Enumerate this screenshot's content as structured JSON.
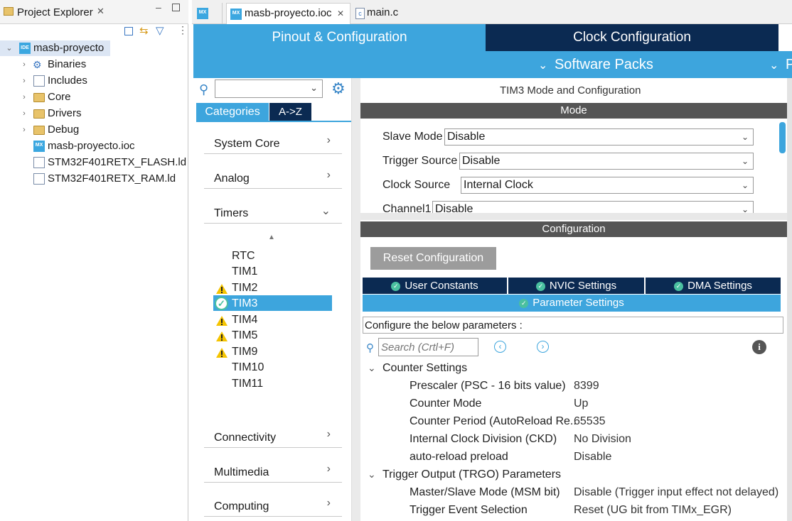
{
  "explorer": {
    "title": "Project Explorer",
    "tree": [
      {
        "label": "masb-proyecto",
        "icon": "ide-project-icon"
      },
      {
        "label": "Binaries",
        "icon": "binaries-icon"
      },
      {
        "label": "Includes",
        "icon": "includes-icon"
      },
      {
        "label": "Core",
        "icon": "folder-icon"
      },
      {
        "label": "Drivers",
        "icon": "folder-icon"
      },
      {
        "label": "Debug",
        "icon": "folder-icon"
      },
      {
        "label": "masb-proyecto.ioc",
        "icon": "mx-file-icon"
      },
      {
        "label": "STM32F401RETX_FLASH.ld",
        "icon": "ld-file-icon"
      },
      {
        "label": "STM32F401RETX_RAM.ld",
        "icon": "ld-file-icon"
      }
    ]
  },
  "editor_tabs": [
    {
      "label": "",
      "icon": "mx-icon"
    },
    {
      "label": "masb-proyecto.ioc",
      "icon": "mx-icon"
    },
    {
      "label": "main.c",
      "icon": "c-file-icon"
    }
  ],
  "top_tabs": {
    "pinout": "Pinout & Configuration",
    "clock": "Clock Configuration",
    "software_packs": "Software Packs",
    "partial_edge": "P"
  },
  "categories": {
    "toggle_categories": "Categories",
    "toggle_az": "A->Z",
    "items": [
      "System Core",
      "Analog",
      "Timers",
      "Connectivity",
      "Multimedia",
      "Computing"
    ],
    "timers": [
      {
        "label": "RTC",
        "status": "none"
      },
      {
        "label": "TIM1",
        "status": "none"
      },
      {
        "label": "TIM2",
        "status": "warning"
      },
      {
        "label": "TIM3",
        "status": "ok"
      },
      {
        "label": "TIM4",
        "status": "warning"
      },
      {
        "label": "TIM5",
        "status": "warning"
      },
      {
        "label": "TIM9",
        "status": "warning"
      },
      {
        "label": "TIM10",
        "status": "none"
      },
      {
        "label": "TIM11",
        "status": "none"
      }
    ]
  },
  "mode": {
    "title": "TIM3 Mode and Configuration",
    "header": "Mode",
    "fields": [
      {
        "label": "Slave Mode",
        "value": "Disable"
      },
      {
        "label": "Trigger Source",
        "value": "Disable"
      },
      {
        "label": "Clock Source",
        "value": "Internal Clock"
      },
      {
        "label": "Channel1",
        "value": "Disable"
      }
    ]
  },
  "configuration": {
    "header": "Configuration",
    "reset_button": "Reset Configuration",
    "tabs": [
      "User Constants",
      "NVIC Settings",
      "DMA Settings"
    ],
    "active_tab": "Parameter Settings",
    "hint": "Configure the below parameters :",
    "search_placeholder": "Search (Crtl+F)",
    "groups": [
      {
        "title": "Counter Settings",
        "params": [
          {
            "name": "Prescaler (PSC - 16 bits value)",
            "value": "8399"
          },
          {
            "name": "Counter Mode",
            "value": "Up"
          },
          {
            "name": "Counter Period (AutoReload Re..",
            "value": "65535"
          },
          {
            "name": "Internal Clock Division (CKD)",
            "value": "No Division"
          },
          {
            "name": "auto-reload preload",
            "value": "Disable"
          }
        ]
      },
      {
        "title": "Trigger Output (TRGO) Parameters",
        "params": [
          {
            "name": "Master/Slave Mode (MSM bit)",
            "value": "Disable (Trigger input effect not delayed)"
          },
          {
            "name": "Trigger Event Selection",
            "value": "Reset (UG bit from TIMx_EGR)"
          }
        ]
      }
    ]
  },
  "colors": {
    "accent_blue": "#3da5dd",
    "dark_navy": "#0b2a52",
    "dark_bar": "#555555",
    "ok_green": "#4ac0a0",
    "warning_yellow": "#f5c400"
  }
}
